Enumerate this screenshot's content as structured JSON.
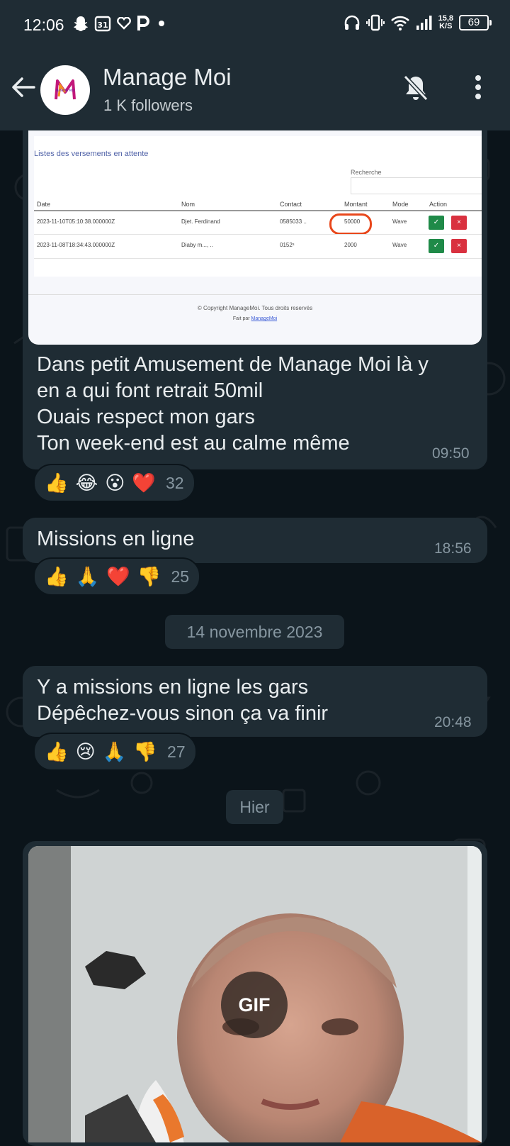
{
  "status_bar": {
    "time": "12:06",
    "net_speed_value": "15,8",
    "net_speed_unit": "K/S",
    "battery": "69"
  },
  "header": {
    "channel_name": "Manage Moi",
    "followers": "1 K followers"
  },
  "screenshot_embed": {
    "title": "Listes des versements en attente",
    "search_label": "Recherche",
    "columns": [
      "Date",
      "Nom",
      "Contact",
      "Montant",
      "Mode",
      "Action"
    ],
    "rows": [
      {
        "date": "2023-11-10T05:10:38.000000Z",
        "nom": "Djet.     Ferdinand",
        "contact": "0585033  ..",
        "montant": "50000",
        "mode": "Wave"
      },
      {
        "date": "2023-11-08T18:34:43.000000Z",
        "nom": "Diaby m...,  ..",
        "contact": "0152ˢ        ",
        "montant": "2000",
        "mode": "Wave"
      }
    ],
    "accept_glyph": "✓",
    "reject_glyph": "×",
    "footer_line1": "© Copyright ManageMoi. Tous droits reservés",
    "footer_line2_prefix": "Fait par ",
    "footer_line2_link": "ManageMoi"
  },
  "messages": [
    {
      "text": "Dans petit Amusement de Manage Moi là y\nen a qui font retrait 50mil\nOuais respect mon gars\nTon week-end est au calme même",
      "time": "09:50",
      "reactions": [
        "👍",
        "😂",
        "😮",
        "❤️"
      ],
      "reaction_count": "32"
    },
    {
      "text": "Missions en ligne",
      "time": "18:56",
      "reactions": [
        "👍",
        "🙏",
        "❤️",
        "👎"
      ],
      "reaction_count": "25"
    },
    {
      "text": "Y a missions en ligne les gars\nDépêchez-vous sinon ça va finir",
      "time": "20:48",
      "reactions": [
        "👍",
        "😢",
        "🙏",
        "👎"
      ],
      "reaction_count": "27"
    }
  ],
  "date_separators": {
    "first": "14 novembre 2023",
    "second": "Hier"
  },
  "gif_label": "GIF",
  "colors": {
    "background": "#0b141a",
    "bubble": "#1f2c34",
    "header": "#1f2c34",
    "meta_text": "#8696a0",
    "accept_green": "#1f8a48",
    "reject_red": "#d9313f",
    "highlight_circle": "#e8471b"
  },
  "icons": [
    "back-arrow-icon",
    "mute-bell-icon",
    "more-options-icon",
    "snapchat-icon",
    "headphones-icon",
    "wifi-icon",
    "signal-icon"
  ]
}
